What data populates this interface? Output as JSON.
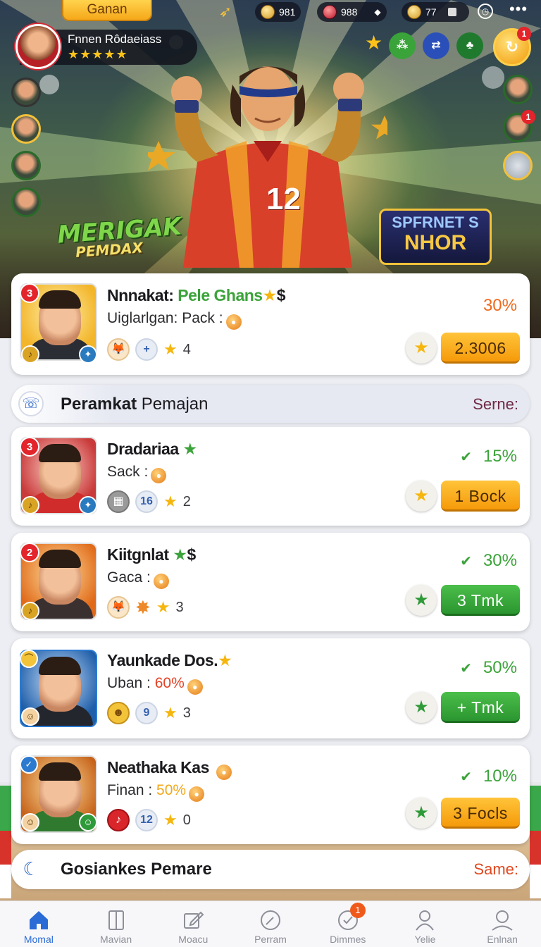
{
  "topbar": {
    "game_tab": "Ganan",
    "currency1": "981",
    "currency2": "988",
    "currency3": "77"
  },
  "player": {
    "name": "Fnnen Rôdaeiass",
    "stars": "★★★★★"
  },
  "side_badges": {
    "avatar3": "1"
  },
  "top_right": {
    "badge": "1",
    "big_label": "↻"
  },
  "hero": {
    "jersey_number": "12",
    "logo_left_main": "MERIGAK",
    "logo_left_sub": "PEMDAX",
    "logo_right_l1": "SPFRNET S",
    "logo_right_l2": "NHOR"
  },
  "featured": {
    "rank": "3",
    "title_prefix": "Nnnakat:",
    "title_highlight": "Pele Ghans",
    "title_suffix": "$",
    "subtitle": "Uiglarlgan: Pack :",
    "count": "4",
    "percent": "30%",
    "action": "2.3006"
  },
  "section1": {
    "title_bold": "Peramkat",
    "title_rest": "Pemajan",
    "right": "Serne:"
  },
  "items": [
    {
      "rank": "3",
      "title": "Dradariaa",
      "sub_label": "Sack :",
      "sub_pct": "",
      "meta_num": "16",
      "count": "2",
      "percent": "15%",
      "action": "1  Bock"
    },
    {
      "rank": "2",
      "title": "Kiitgnlat",
      "sub_label": "Gaca :",
      "sub_pct": "",
      "meta_num": "",
      "count": "3",
      "percent": "30%",
      "action": "3  Tmk"
    },
    {
      "rank": "",
      "title": "Yaunkade Dos.",
      "sub_label": "Uban :",
      "sub_pct": "60%",
      "meta_num": "9",
      "count": "3",
      "percent": "50%",
      "action": "+  Tmk"
    },
    {
      "rank": "",
      "title": "Neathaka Kas",
      "sub_label": "Finan :",
      "sub_pct": "50%",
      "meta_num": "12",
      "count": "0",
      "percent": "10%",
      "action": "3  Focls"
    }
  ],
  "section2": {
    "title": "Gosiankes Pemare",
    "right": "Same:"
  },
  "nav": [
    {
      "label": "Momal",
      "icon": "home-icon",
      "badge": ""
    },
    {
      "label": "Mavian",
      "icon": "locker-icon",
      "badge": ""
    },
    {
      "label": "Moacu",
      "icon": "edit-icon",
      "badge": ""
    },
    {
      "label": "Perram",
      "icon": "compass-icon",
      "badge": ""
    },
    {
      "label": "Dimmes",
      "icon": "check-circle-icon",
      "badge": "1"
    },
    {
      "label": "Yelie",
      "icon": "user-icon",
      "badge": ""
    },
    {
      "label": "Enlnan",
      "icon": "profile-icon",
      "badge": ""
    }
  ],
  "colors": {
    "accent_green": "#3ba33a",
    "accent_orange": "#f59a0a",
    "badge_red": "#e3242b",
    "nav_active": "#2a6bd6"
  }
}
